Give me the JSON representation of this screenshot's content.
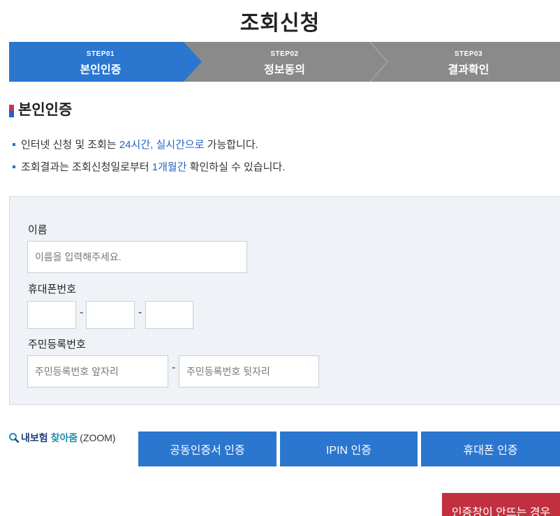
{
  "page": {
    "title": "조회신청"
  },
  "steps": [
    {
      "num": "STEP01",
      "label": "본인인증",
      "state": "active"
    },
    {
      "num": "STEP02",
      "label": "정보동의",
      "state": "inactive"
    },
    {
      "num": "STEP03",
      "label": "결과확인",
      "state": "inactive"
    }
  ],
  "colors": {
    "active_step": "#2b76cf",
    "inactive_step": "#8a8a8a",
    "accent": "#2b76cf",
    "highlight_text": "#1f63c5",
    "help_button": "#c1303f",
    "form_bg": "#eff2f6"
  },
  "section": {
    "title": "본인인증"
  },
  "notices": [
    {
      "pre": "인터넷 신청 및 조회는 ",
      "hl": "24시간, 실시간으로",
      "post": " 가능합니다."
    },
    {
      "pre": "조회결과는 조회신청일로부터 ",
      "hl": "1개월간",
      "post": " 확인하실 수 있습니다."
    }
  ],
  "form": {
    "name_label": "이름",
    "name_placeholder": "이름을 입력해주세요.",
    "phone_label": "휴대폰번호",
    "phone_sep": "-",
    "rrn_label": "주민등록번호",
    "rrn_front_placeholder": "주민등록번호 앞자리",
    "rrn_sep": "-",
    "rrn_back_placeholder": "주민등록번호 뒷자리"
  },
  "zoom": {
    "icon": "search-icon",
    "part1": "내보험",
    "part2": "찾아줌",
    "part3": "(ZOOM)"
  },
  "auth_buttons": {
    "cert": "공동인증서 인증",
    "ipin": "IPIN 인증",
    "phone": "휴대폰 인증"
  },
  "help_button": {
    "label": "인증창이 안뜨는 경우"
  }
}
